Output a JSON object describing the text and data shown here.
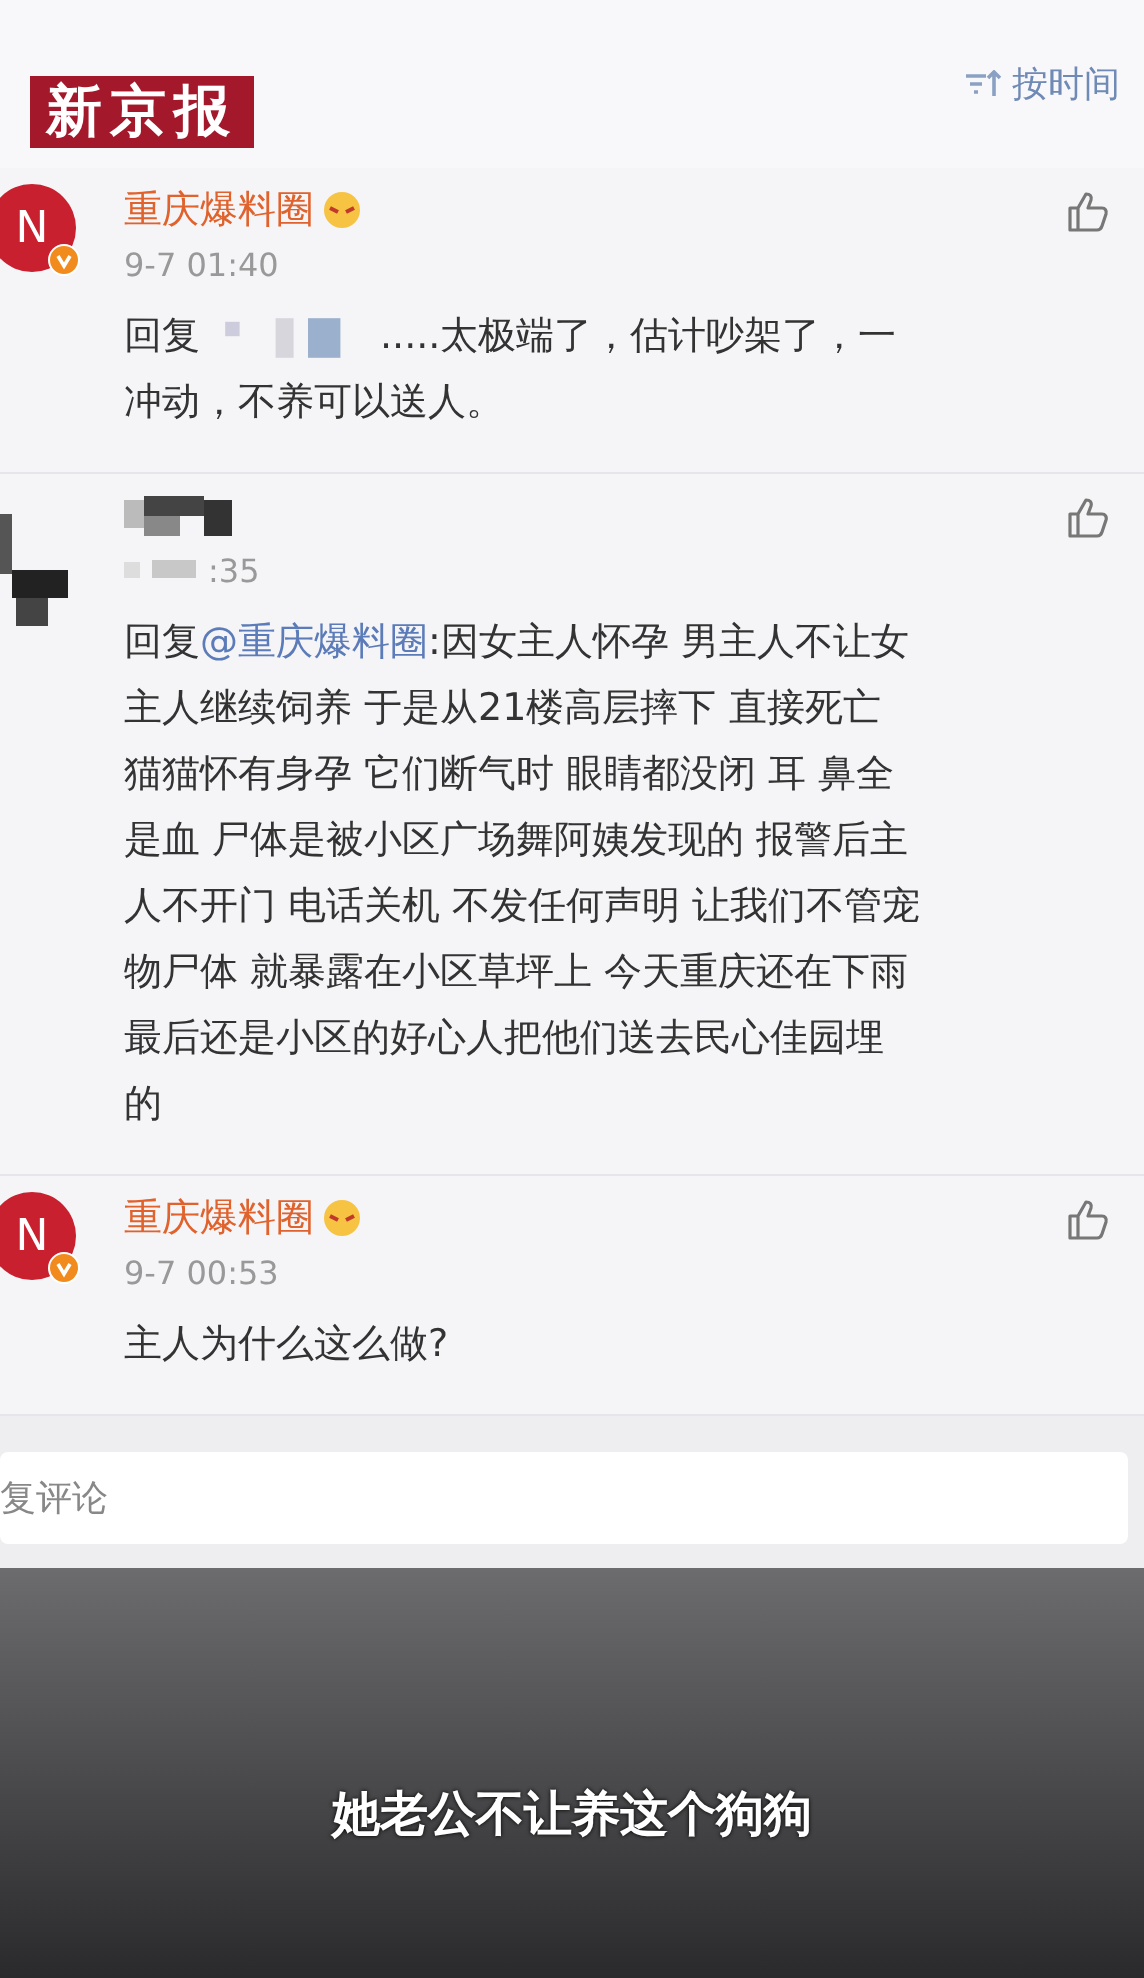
{
  "header": {
    "logo": "新京报",
    "sort_label": "按时间"
  },
  "comments": [
    {
      "name": "重庆爆料圈",
      "name_blurred": false,
      "avatar_letter": "N",
      "verified": true,
      "emoji": true,
      "time": "9-7 01:40",
      "time_blurred": false,
      "reply_prefix": "回复",
      "reply_target_blurred": true,
      "text": [
        ".....太极端了，估计吵架了，一",
        "冲动，不养可以送人。"
      ]
    },
    {
      "name_blurred": true,
      "verified": false,
      "emoji": false,
      "time": ":35",
      "time_blurred": true,
      "reply_prefix": "回复",
      "mention": "@重庆爆料圈",
      "reply_target_blurred": false,
      "text": [
        ":因女主人怀孕 男主人不让女",
        "主人继续饲养 于是从21楼高层摔下 直接死亡",
        "猫猫怀有身孕 它们断气时 眼睛都没闭 耳 鼻全",
        "是血 尸体是被小区广场舞阿姨发现的 报警后主",
        "人不开门 电话关机 不发任何声明 让我们不管宠",
        "物尸体 就暴露在小区草坪上 今天重庆还在下雨",
        "最后还是小区的好心人把他们送去民心佳园埋",
        "的"
      ]
    },
    {
      "name": "重庆爆料圈",
      "name_blurred": false,
      "avatar_letter": "N",
      "verified": true,
      "emoji": true,
      "time": "9-7 00:53",
      "time_blurred": false,
      "reply_target_blurred": false,
      "text": [
        "主人为什么这么做?"
      ]
    }
  ],
  "reply_box": {
    "placeholder": "复评论"
  },
  "subtitle": "她老公不让养这个狗狗"
}
